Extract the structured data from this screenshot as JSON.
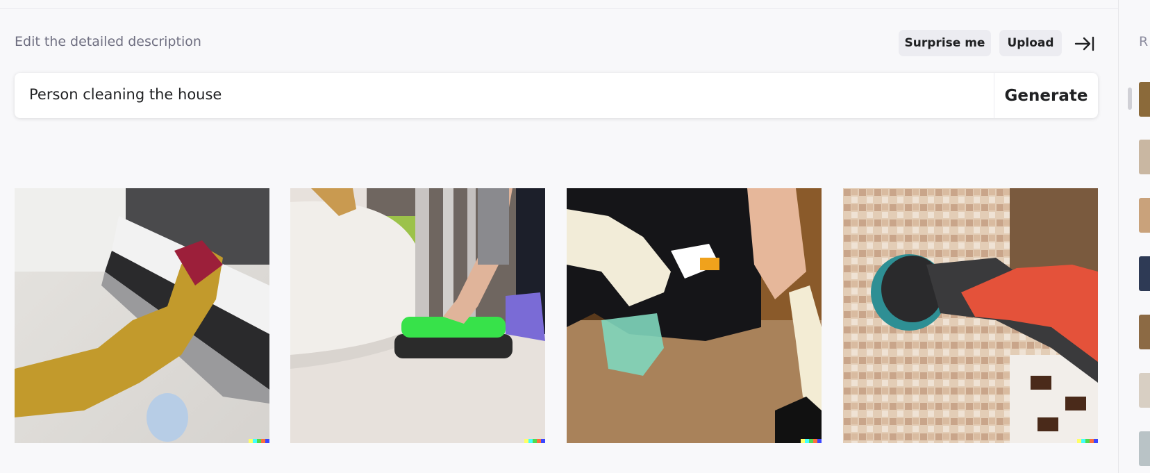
{
  "editor": {
    "label": "Edit the detailed description",
    "surprise_label": "Surprise me",
    "upload_label": "Upload",
    "prompt_value": "Person cleaning the house",
    "generate_label": "Generate"
  },
  "results": [
    {
      "scene": "yellow-gloved hand wiping oven door"
    },
    {
      "scene": "hand scrubbing floor with green pad"
    },
    {
      "scene": "gloved hand with spray bottle over carpet"
    },
    {
      "scene": "red-gloved hand scrubbing tiled wall"
    }
  ],
  "history": {
    "label": "R",
    "thumbnail_colors": [
      "#8b6a3a",
      "#c9b7a2",
      "#c9a27b",
      "#2e3a55",
      "#8c6a44",
      "#d8cfc3",
      "#b9c3c6"
    ]
  },
  "colors": {
    "background": "#f8f8fa",
    "button_bg": "#ececf1",
    "text": "#202123",
    "muted": "#6e6e80"
  }
}
